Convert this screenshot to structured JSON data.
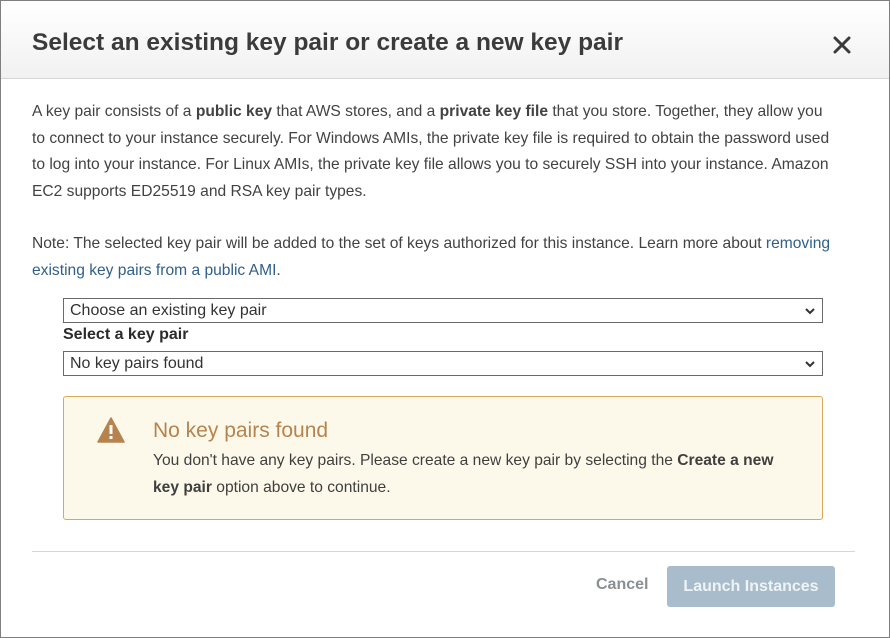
{
  "dialog": {
    "title": "Select an existing key pair or create a new key pair",
    "intro": {
      "t1": "A key pair consists of a ",
      "b1": "public key",
      "t2": " that AWS stores, and a ",
      "b2": "private key file",
      "t3": " that you store. Together, they allow you to connect to your instance securely. For Windows AMIs, the private key file is required to obtain the password used to log into your instance. For Linux AMIs, the private key file allows you to securely SSH into your instance. Amazon EC2 supports ED25519 and RSA key pair types."
    },
    "note": {
      "text": "Note: The selected key pair will be added to the set of keys authorized for this instance. Learn more about ",
      "link": "removing existing key pairs from a public AMI",
      "end": "."
    },
    "keypair_option": {
      "value": "Choose an existing key pair"
    },
    "select_key_pair": {
      "label": "Select a key pair",
      "value": "No key pairs found"
    },
    "alert": {
      "title": "No key pairs found",
      "text": "You don't have any key pairs. Please create a new key pair by selecting the ",
      "bold": "Create a new key pair",
      "end": " option above to continue.",
      "icon": "warning-icon",
      "color": "#b6834e"
    },
    "buttons": {
      "cancel": "Cancel",
      "launch": "Launch Instances"
    },
    "icons": {
      "close": "close-icon",
      "dropdown": "chevron-down-icon"
    }
  }
}
